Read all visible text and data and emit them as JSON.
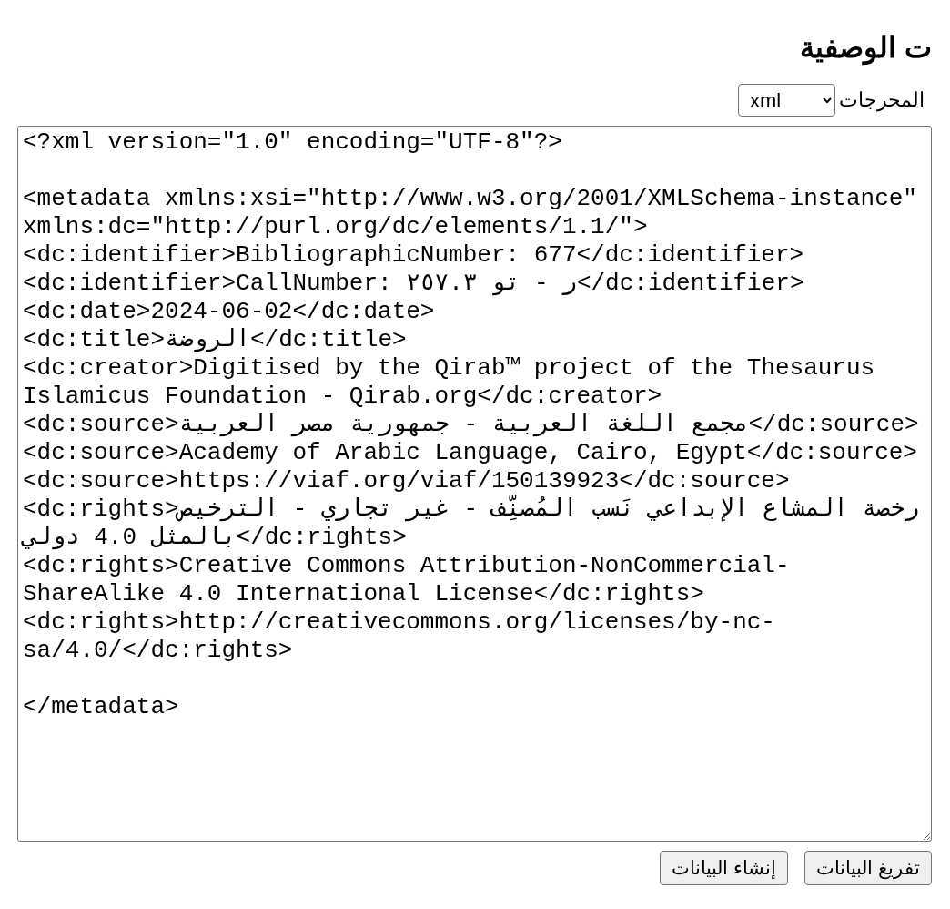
{
  "heading": "ت الوصفية",
  "output": {
    "label": "المخرجات",
    "value": "xml"
  },
  "editor": {
    "value": "<?xml version=\"1.0\" encoding=\"UTF-8\"?>\n\n<metadata xmlns:xsi=\"http://www.w3.org/2001/XMLSchema-instance\" xmlns:dc=\"http://purl.org/dc/elements/1.1/\">\n<dc:identifier>BibliographicNumber: 677</dc:identifier>\n<dc:identifier>CallNumber: ر - تو ٢٥٧.٣</dc:identifier>\n<dc:date>2024-06-02</dc:date>\n<dc:title>الروضة</dc:title>\n<dc:creator>Digitised by the Qirab™ project of the Thesaurus Islamicus Foundation - Qirab.org</dc:creator>\n<dc:source>مجمع اللغة العربية - جمهورية مصر العربية</dc:source>\n<dc:source>Academy of Arabic Language, Cairo, Egypt</dc:source>\n<dc:source>https://viaf.org/viaf/150139923</dc:source>\n<dc:rights>رخصة المشاع الإبداعي نَسب المُصنِّف - غير تجاري - الترخيص بالمثل 4.0 دولي</dc:rights>\n<dc:rights>Creative Commons Attribution-NonCommercial-ShareAlike 4.0 International License</dc:rights>\n<dc:rights>http://creativecommons.org/licenses/by-nc-sa/4.0/</dc:rights>\n\n</metadata>"
  },
  "buttons": [
    "تفريغ البيانات",
    "إنشاء البيانات"
  ]
}
